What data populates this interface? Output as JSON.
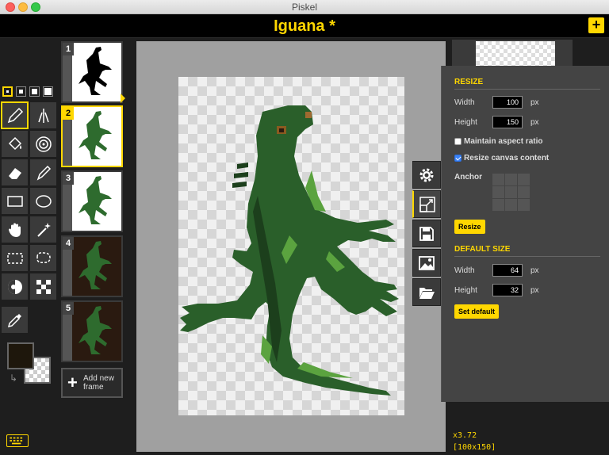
{
  "window": {
    "title": "Piskel"
  },
  "header": {
    "doc_title": "Iguana *",
    "add_label": "+"
  },
  "tools": {
    "pen_sizes": [
      "1",
      "2",
      "3",
      "4"
    ],
    "selected_pen_size": 1,
    "items": [
      "pen",
      "vertical-mirror-pen",
      "paint-bucket",
      "paint-same-color",
      "eraser",
      "stroke",
      "rectangle",
      "circle",
      "move",
      "shape-selection",
      "rectangle-selection",
      "lasso-selection",
      "lighten",
      "dithering",
      "color-picker"
    ],
    "selected": "pen"
  },
  "colors": {
    "primary": "#1e170c",
    "secondary": "transparent"
  },
  "frames": {
    "items": [
      {
        "number": "1",
        "style": "black"
      },
      {
        "number": "2",
        "style": "green"
      },
      {
        "number": "3",
        "style": "green"
      },
      {
        "number": "4",
        "style": "dark"
      },
      {
        "number": "5",
        "style": "dark"
      }
    ],
    "selected": 2,
    "add_label": "Add new frame"
  },
  "status": {
    "zoom": "x3.72",
    "dims": "[100x150]"
  },
  "resize": {
    "title": "RESIZE",
    "width_label": "Width",
    "width_value": "100",
    "height_label": "Height",
    "height_value": "150",
    "unit": "px",
    "maintain_label": "Maintain aspect ratio",
    "maintain_checked": false,
    "resize_content_label": "Resize canvas content",
    "resize_content_checked": true,
    "anchor_label": "Anchor",
    "button": "Resize"
  },
  "default_size": {
    "title": "DEFAULT SIZE",
    "width_label": "Width",
    "width_value": "64",
    "height_label": "Height",
    "height_value": "32",
    "unit": "px",
    "button": "Set default"
  },
  "accent": "#ffd700"
}
